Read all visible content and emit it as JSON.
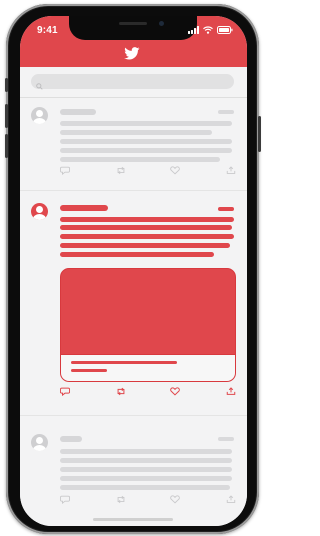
{
  "status_bar": {
    "time": "9:41"
  },
  "header": {
    "logo_icon": "twitter-bird-icon"
  },
  "search": {
    "icon": "search-icon"
  },
  "tweets": [
    {
      "state": "default",
      "avatar_icon": "default-avatar-icon"
    },
    {
      "state": "highlighted",
      "avatar_icon": "default-avatar-icon",
      "has_media": true
    },
    {
      "state": "default",
      "avatar_icon": "default-avatar-icon"
    }
  ],
  "actions": [
    "reply-icon",
    "retweet-icon",
    "like-icon",
    "share-icon"
  ],
  "colors": {
    "brand_red": "#e0474c",
    "placeholder_gray": "#d9d9db",
    "background": "#f3f3f4"
  }
}
